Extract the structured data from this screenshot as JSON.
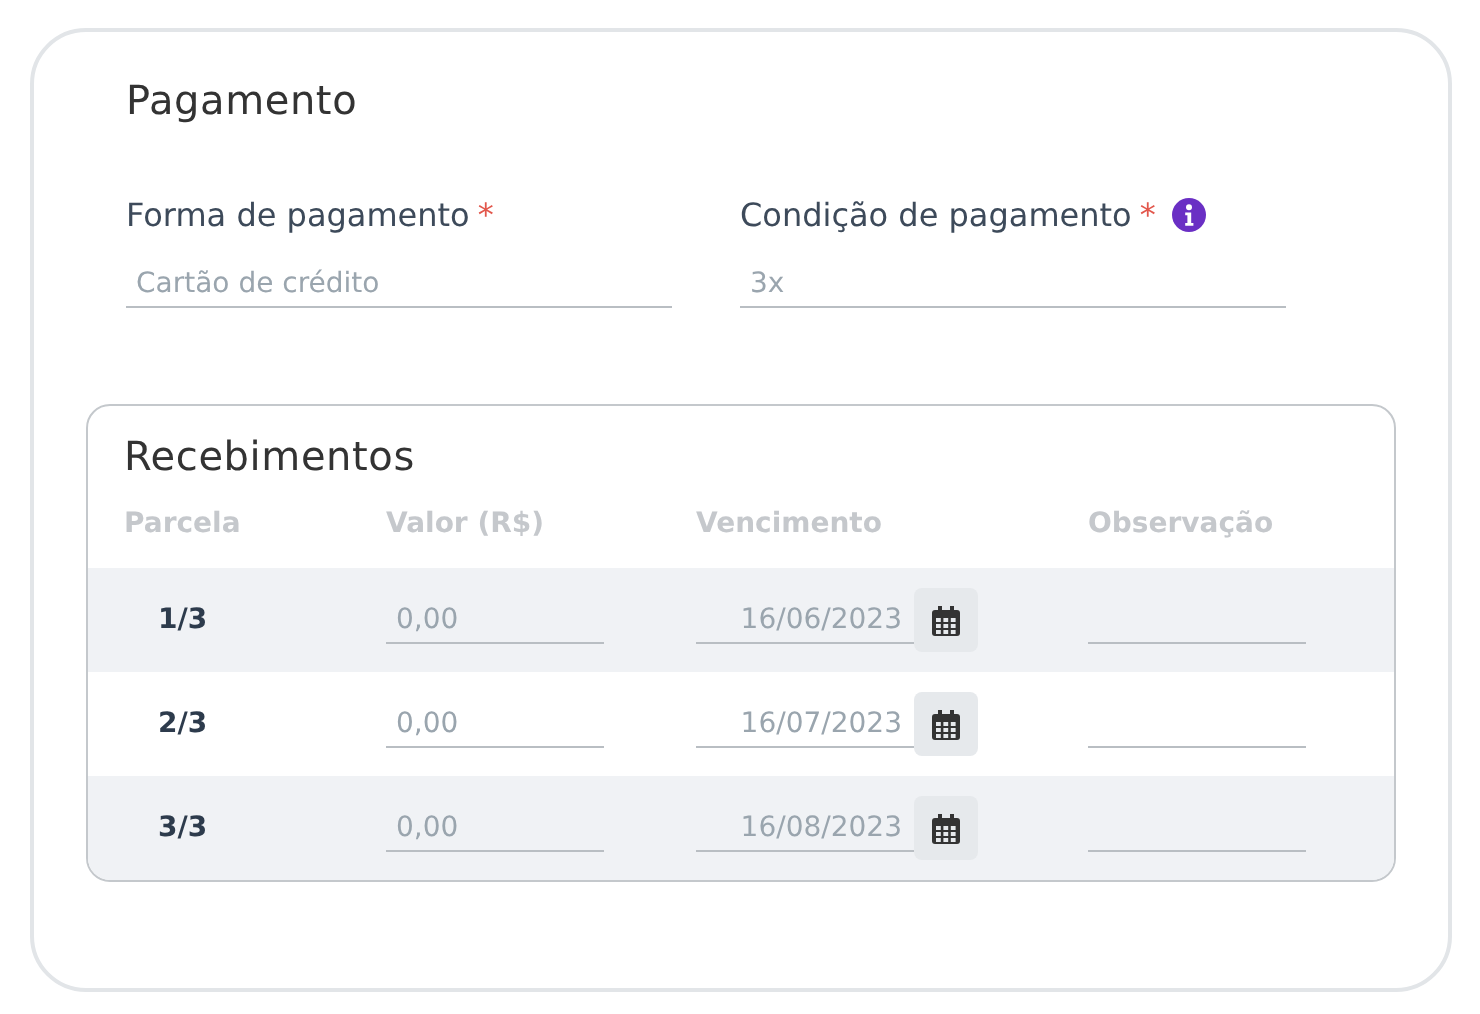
{
  "title": "Pagamento",
  "fields": [
    {
      "label": "Forma de pagamento",
      "required_mark": "*",
      "info": false,
      "value": "Cartão de crédito"
    },
    {
      "label": "Condição de pagamento",
      "required_mark": "*",
      "info": true,
      "value": "3x"
    }
  ],
  "receipts": {
    "title": "Recebimentos",
    "columns": [
      "Parcela",
      "Valor (R$)",
      "Vencimento",
      "Observação"
    ],
    "rows": [
      {
        "installment": "1/3",
        "amount": "0,00",
        "due": "16/06/2023"
      },
      {
        "installment": "2/3",
        "amount": "0,00",
        "due": "16/07/2023"
      },
      {
        "installment": "3/3",
        "amount": "0,00",
        "due": "16/08/2023"
      }
    ]
  }
}
